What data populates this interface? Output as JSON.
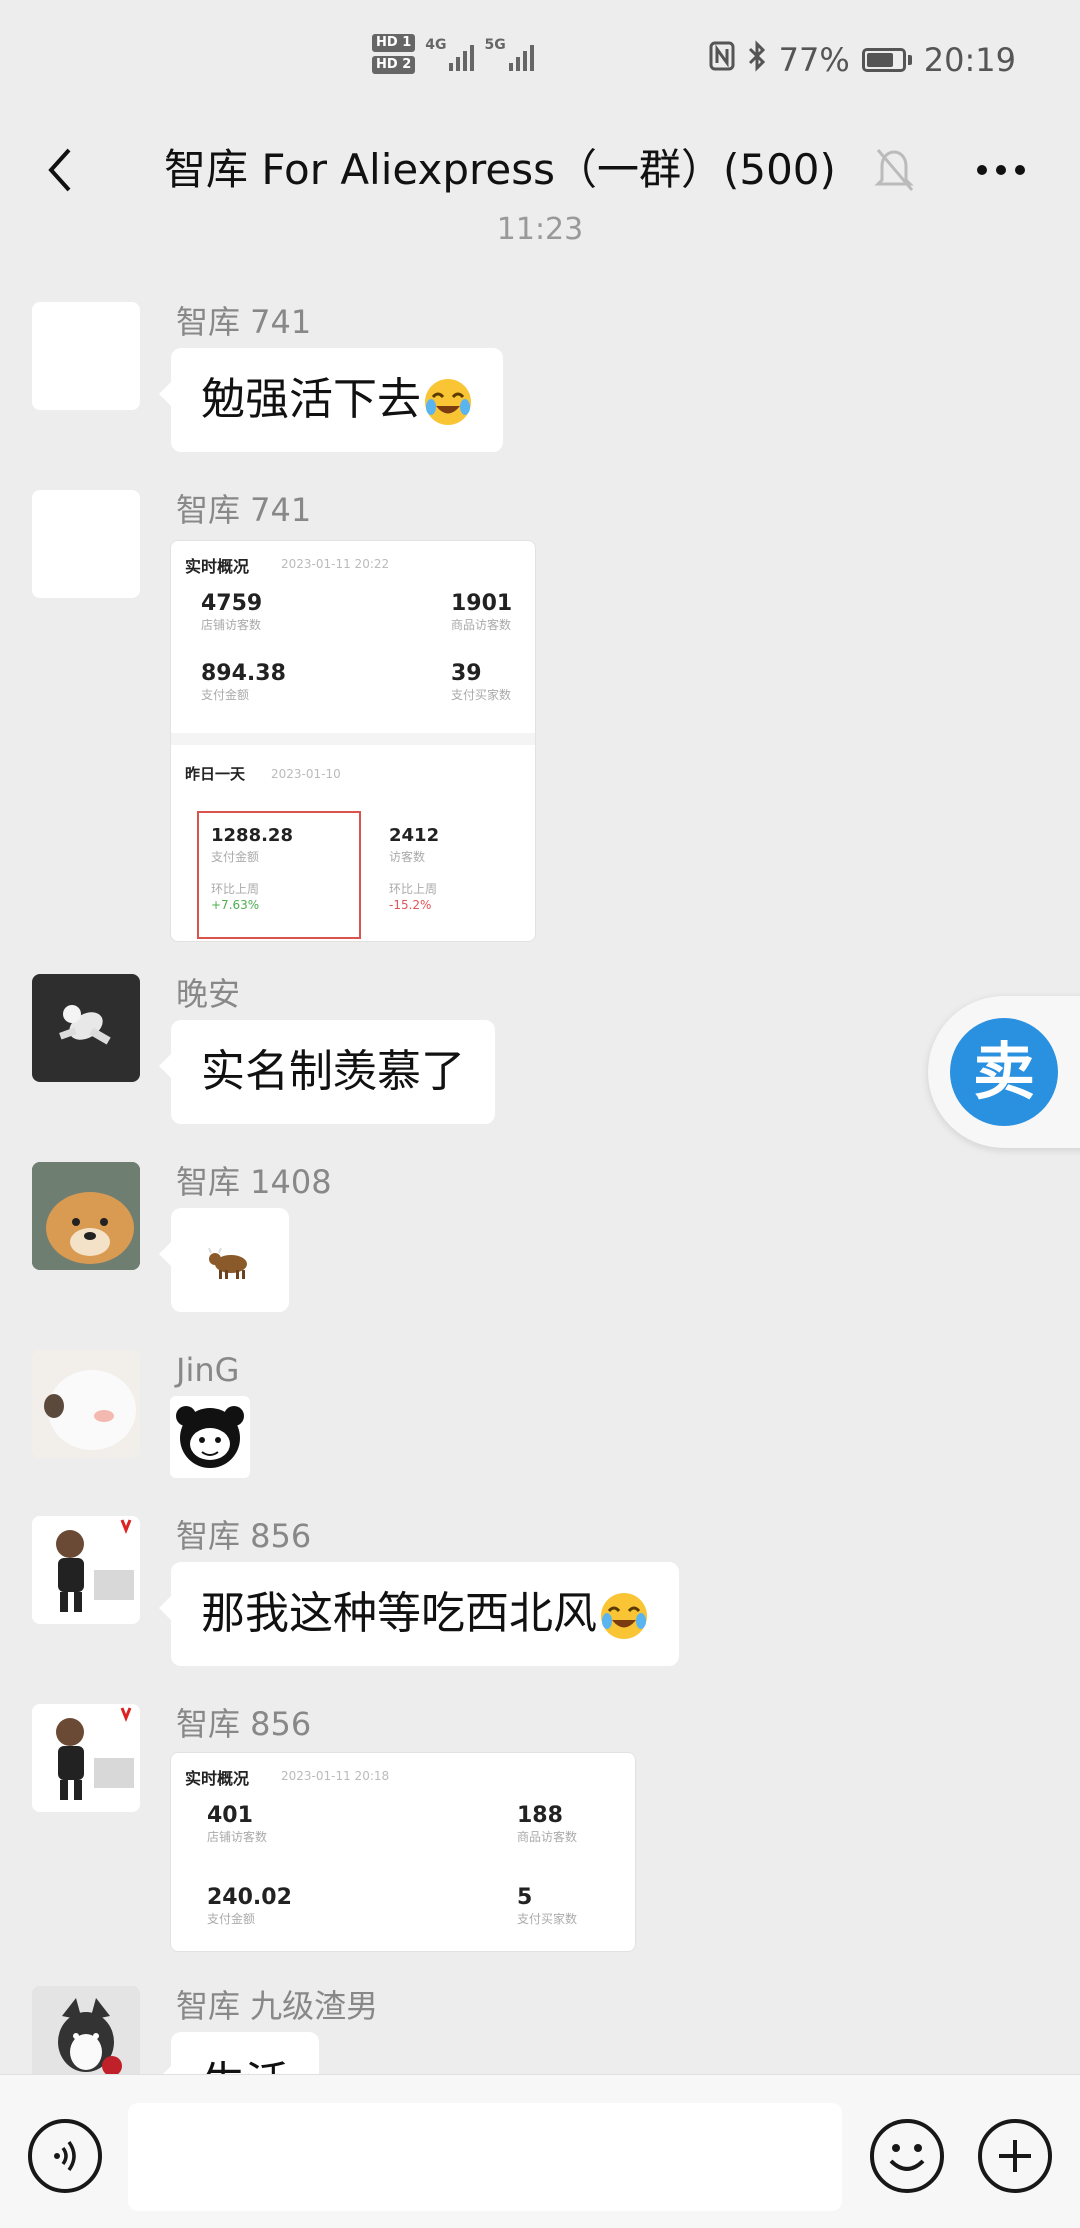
{
  "status_bar": {
    "sim1": "HD 1",
    "sim2": "HD 2",
    "net1": "4G",
    "net2": "5G",
    "battery": "77%",
    "battery_level": 0.77,
    "time": "20:19"
  },
  "header": {
    "title": "智库 For Aliexpress（一群）(500)",
    "back_icon": "chevron-left-icon",
    "mute_icon": "bell-off-icon",
    "more_icon": "more-dots-icon"
  },
  "timestamp": "11:23",
  "messages": [
    {
      "sender": "智库 741",
      "text": "勉强活下去",
      "emoji": "crying-laughing-emoji"
    },
    {
      "sender": "智库 741",
      "card": {
        "title": "实时概况",
        "date": "2023-01-11 20:22",
        "stats": [
          {
            "value": "4759",
            "label": "店铺访客数"
          },
          {
            "value": "1901",
            "label": "商品访客数"
          },
          {
            "value": "894.38",
            "label": "支付金额"
          },
          {
            "value": "39",
            "label": "支付买家数"
          }
        ],
        "section": "昨日一天",
        "section_date": "2023-01-10",
        "stats2": [
          {
            "value": "1288.28",
            "label": "支付金额",
            "sub": "环比上周",
            "change": "+7.63%"
          },
          {
            "value": "2412",
            "label": "访客数",
            "sub": "环比上周",
            "change": "-15.2%"
          }
        ]
      }
    },
    {
      "sender": "晚安",
      "text": "实名制羡慕了"
    },
    {
      "sender": "智库 1408",
      "emoji_only": "ox-emoji"
    },
    {
      "sender": "JinG",
      "sticker": "panda-meme-sticker"
    },
    {
      "sender": "智库 856",
      "text": "那我这种等吃西北风",
      "emoji": "crying-laughing-emoji"
    },
    {
      "sender": "智库 856",
      "card": {
        "title": "实时概况",
        "date": "2023-01-11 20:18",
        "stats": [
          {
            "value": "401",
            "label": "店铺访客数"
          },
          {
            "value": "188",
            "label": "商品访客数"
          },
          {
            "value": "240.02",
            "label": "支付金额"
          },
          {
            "value": "5",
            "label": "支付买家数"
          }
        ]
      }
    },
    {
      "sender": "智库 九级渣男",
      "text": "生活"
    }
  ],
  "floating_button": {
    "label": "卖"
  },
  "input_bar": {
    "placeholder": "",
    "voice_icon": "voice-icon",
    "emoji_icon": "smiley-icon",
    "plus_icon": "plus-icon"
  },
  "colors": {
    "background": "#ededed",
    "bubble": "#ffffff",
    "accent": "#2a90e0"
  }
}
